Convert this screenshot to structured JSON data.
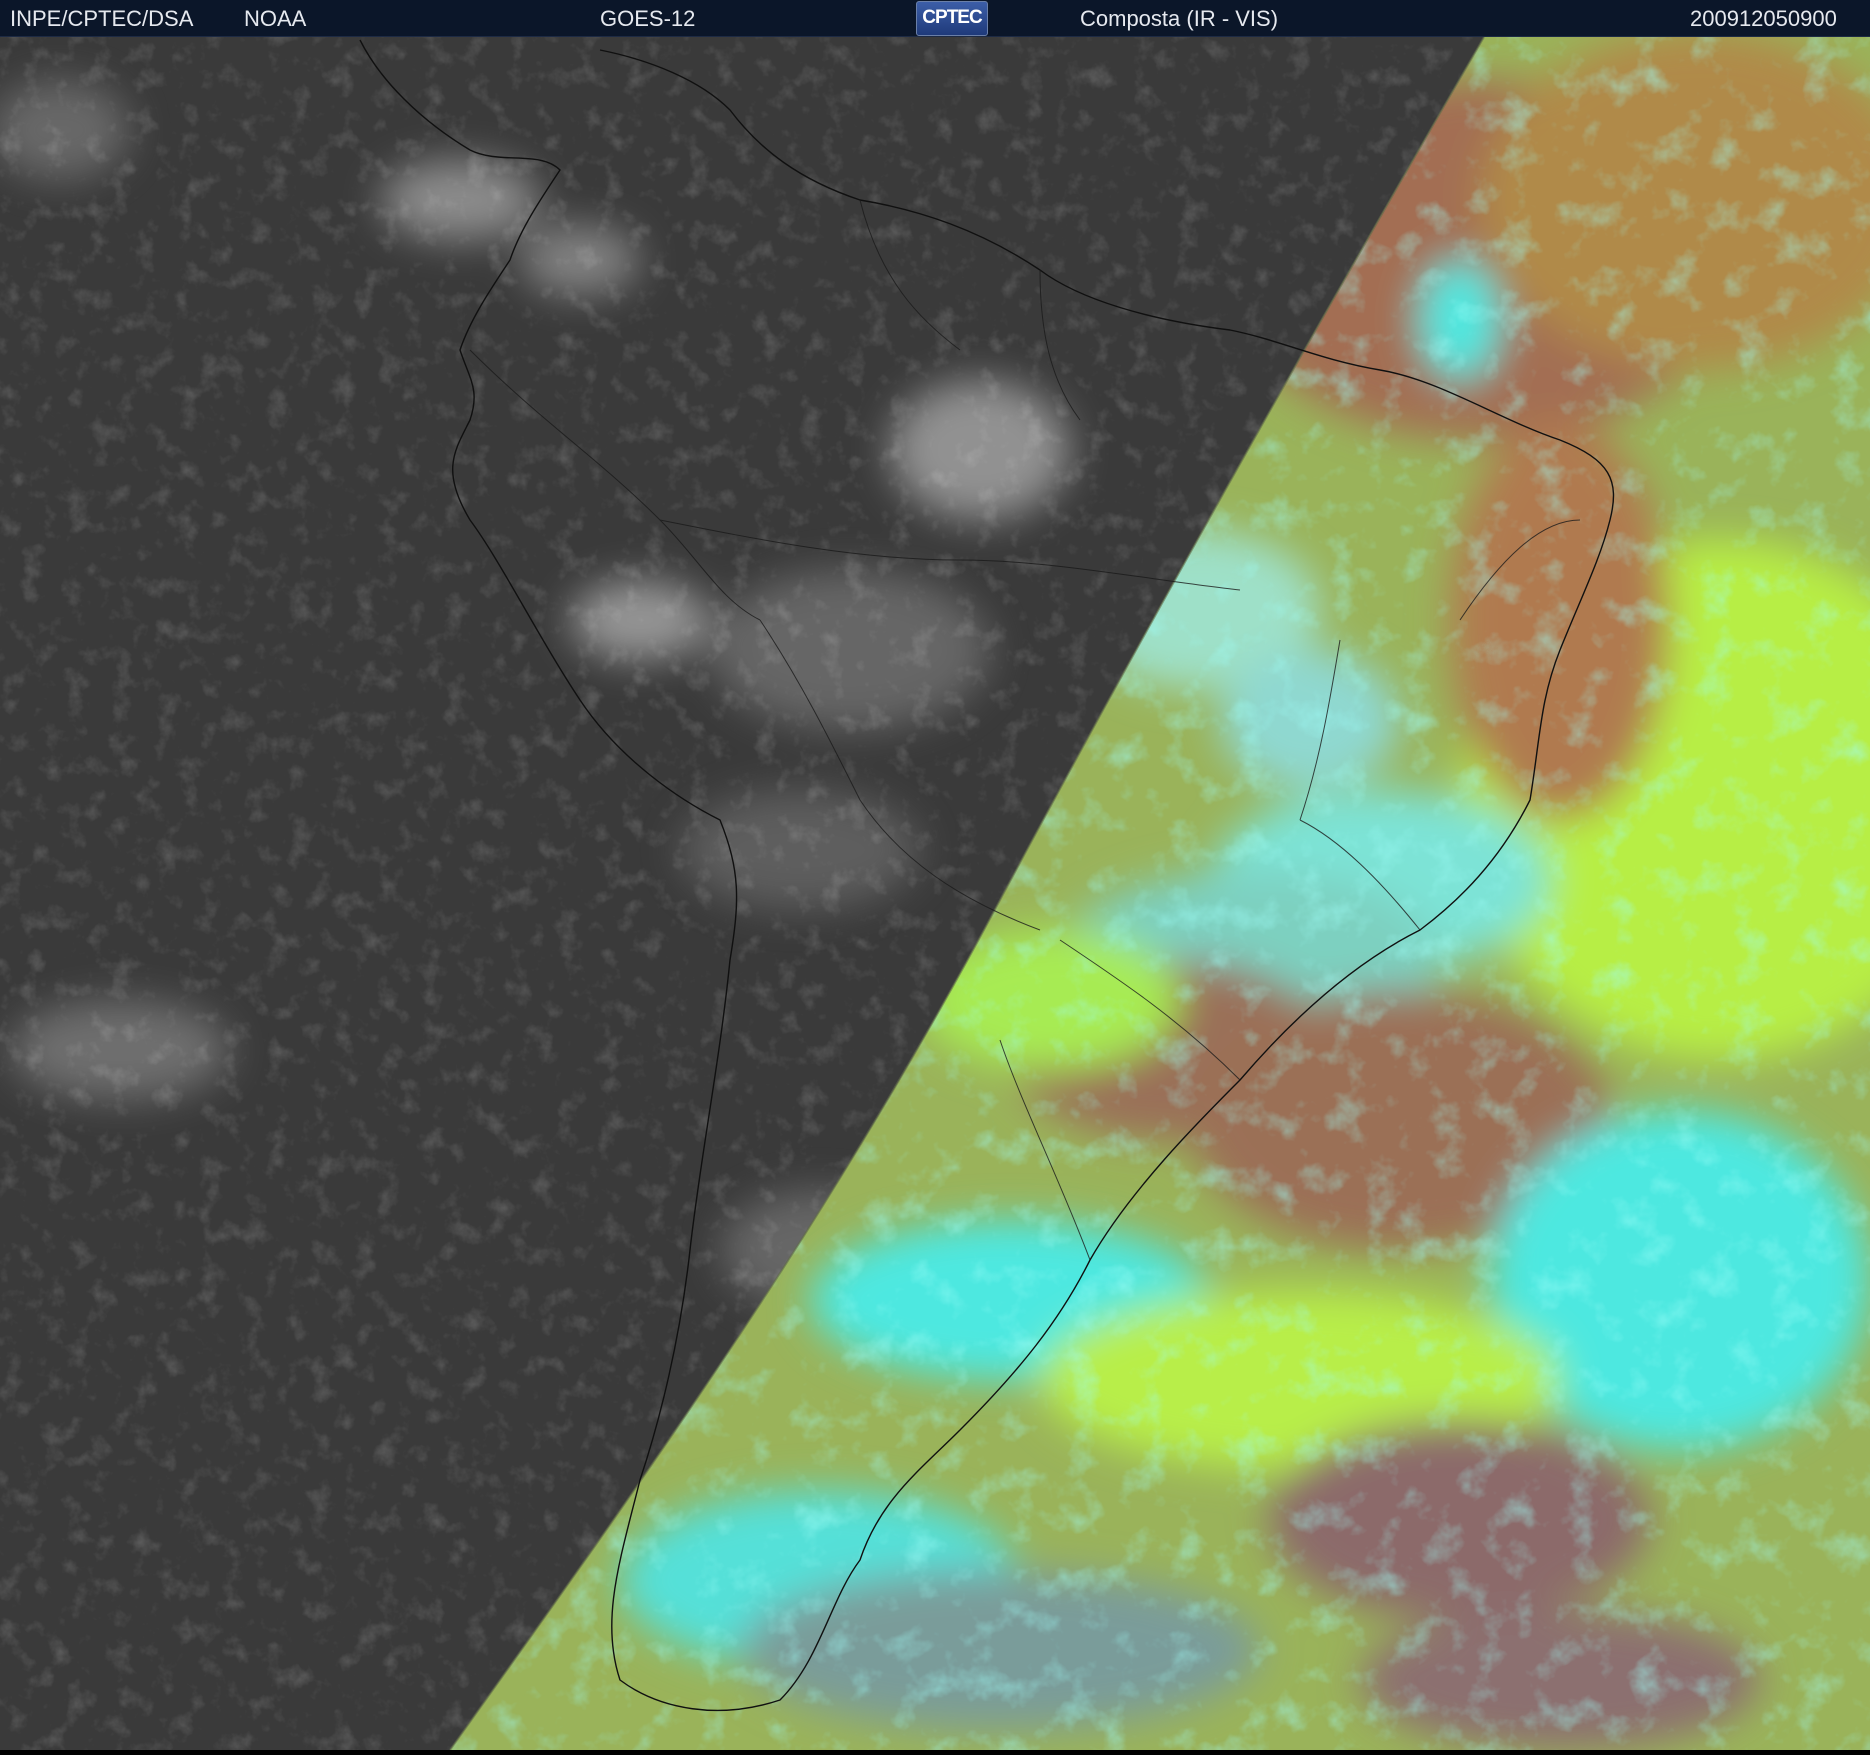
{
  "header": {
    "left_text": "INPE/CPTEC/DSA",
    "agency": "NOAA",
    "satellite": "GOES-12",
    "logo_text": "CPTEC",
    "product": "Composta (IR - VIS)",
    "timestamp": "200912050900"
  },
  "colors": {
    "header_bg": "#0b1629",
    "header_text": "#e6e9ef",
    "night_side": "#3a3a3a",
    "day_clear_sea": "#9ab35a",
    "day_cloud_cyan": "#4ee8e0",
    "day_land_brown": "#9a6e52",
    "day_bright_green": "#b8ee4a"
  },
  "map": {
    "projection_view": "full-disk-subset",
    "region": "South America",
    "terminator": "day-night boundary arc"
  }
}
